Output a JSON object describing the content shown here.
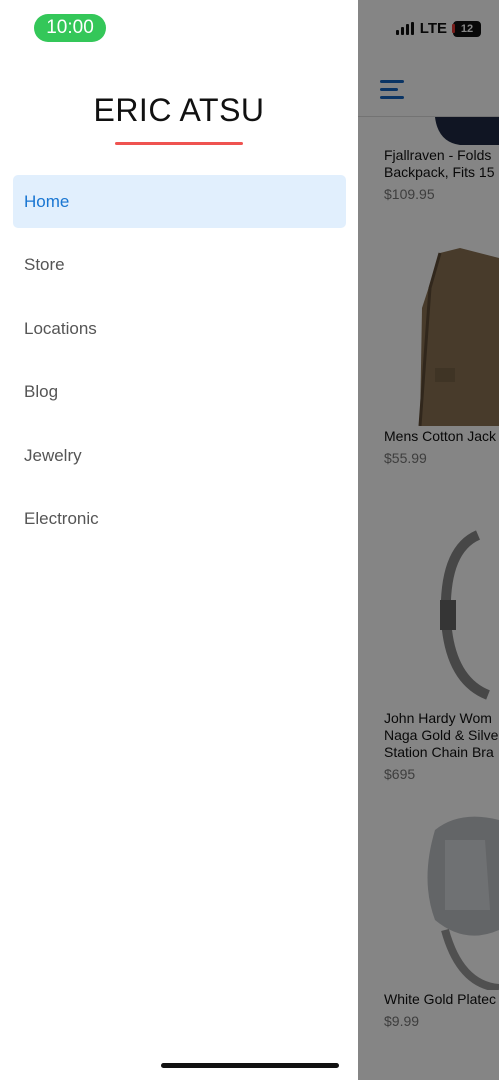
{
  "status_bar": {
    "time": "10:00",
    "network": "LTE",
    "battery": "12"
  },
  "drawer": {
    "title": "ERIC ATSU",
    "nav_items": [
      {
        "label": "Home",
        "active": true
      },
      {
        "label": "Store",
        "active": false
      },
      {
        "label": "Locations",
        "active": false
      },
      {
        "label": "Blog",
        "active": false
      },
      {
        "label": "Jewelry",
        "active": false
      },
      {
        "label": "Electronic",
        "active": false
      }
    ]
  },
  "background_screen": {
    "menu_icon": "hamburger-icon",
    "products": [
      {
        "title": "Fjallraven - Folds\nBackpack, Fits 15",
        "price": "$109.95"
      },
      {
        "title": "Mens Cotton Jack",
        "price": "$55.99"
      },
      {
        "title": "John Hardy Wom\nNaga Gold & Silve\nStation Chain Bra",
        "price": "$695"
      },
      {
        "title": "White Gold Platec",
        "price": "$9.99"
      }
    ]
  },
  "colors": {
    "accent": "#1976d2",
    "active_bg": "#e1effd",
    "underline": "#ef5350",
    "time_pill": "#34c759"
  }
}
